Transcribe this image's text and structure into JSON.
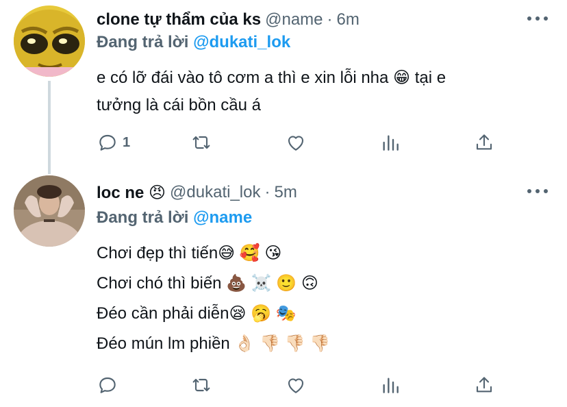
{
  "tweets": [
    {
      "display_name": "clone tự thẩm của ks",
      "handle": "@name",
      "separator": "·",
      "time": "6m",
      "replying_prefix": "Đang trả lời",
      "replying_to": "@dukati_lok",
      "text_lines": [
        "e có lỡ đái vào tô cơm a thì e xin lỗi nha 😁  tại e",
        "tưởng là cái bồn cầu á"
      ],
      "reply_count": "1",
      "avatar_icon": "cartoon-face-avatar"
    },
    {
      "display_name": "loc ne 😠",
      "handle": "@dukati_lok",
      "separator": "·",
      "time": "5m",
      "replying_prefix": "Đang trả lời",
      "replying_to": "@name",
      "text_lines": [
        "Chơi đẹp thì tiến😅 🥰 😘",
        "Chơi chó thì biến 💩 ☠️ 🙂 🙃",
        "Đéo cần phải diễn😪 🥱 🎭",
        "Đéo mún lm phiền 👌🏻 👎🏻 👎🏻 👎🏻"
      ],
      "reply_count": "",
      "avatar_icon": "person-photo-avatar"
    }
  ],
  "icons": {
    "reply": "reply-bubble-icon",
    "retweet": "retweet-icon",
    "like": "heart-icon",
    "stats": "stats-bar-icon",
    "share": "share-upload-icon",
    "more": "more-dots-icon"
  },
  "colors": {
    "text": "#0f1419",
    "secondary": "#536471",
    "link": "#1d9bf0",
    "thread_line": "#cfd9de"
  }
}
